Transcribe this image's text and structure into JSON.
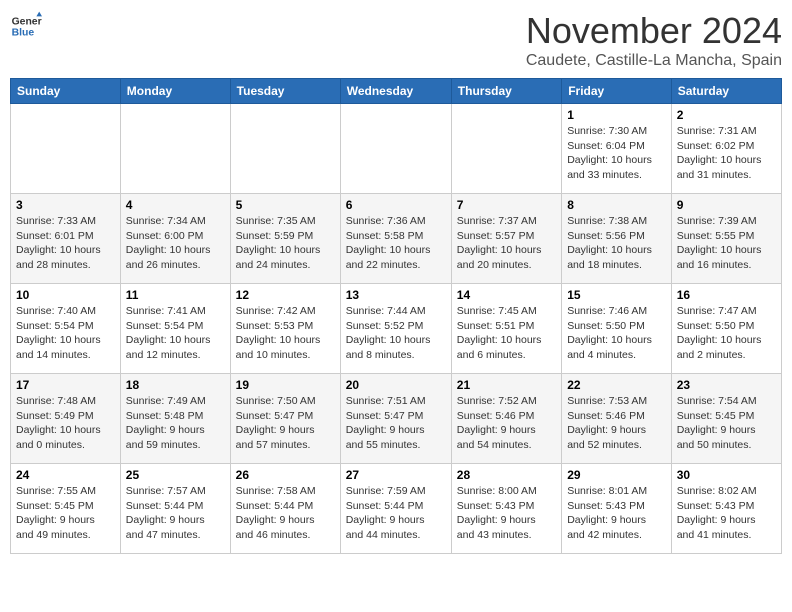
{
  "header": {
    "logo_general": "General",
    "logo_blue": "Blue",
    "month_title": "November 2024",
    "location": "Caudete, Castille-La Mancha, Spain"
  },
  "calendar": {
    "days_of_week": [
      "Sunday",
      "Monday",
      "Tuesday",
      "Wednesday",
      "Thursday",
      "Friday",
      "Saturday"
    ],
    "weeks": [
      [
        {
          "day": "",
          "info": ""
        },
        {
          "day": "",
          "info": ""
        },
        {
          "day": "",
          "info": ""
        },
        {
          "day": "",
          "info": ""
        },
        {
          "day": "",
          "info": ""
        },
        {
          "day": "1",
          "info": "Sunrise: 7:30 AM\nSunset: 6:04 PM\nDaylight: 10 hours\nand 33 minutes."
        },
        {
          "day": "2",
          "info": "Sunrise: 7:31 AM\nSunset: 6:02 PM\nDaylight: 10 hours\nand 31 minutes."
        }
      ],
      [
        {
          "day": "3",
          "info": "Sunrise: 7:33 AM\nSunset: 6:01 PM\nDaylight: 10 hours\nand 28 minutes."
        },
        {
          "day": "4",
          "info": "Sunrise: 7:34 AM\nSunset: 6:00 PM\nDaylight: 10 hours\nand 26 minutes."
        },
        {
          "day": "5",
          "info": "Sunrise: 7:35 AM\nSunset: 5:59 PM\nDaylight: 10 hours\nand 24 minutes."
        },
        {
          "day": "6",
          "info": "Sunrise: 7:36 AM\nSunset: 5:58 PM\nDaylight: 10 hours\nand 22 minutes."
        },
        {
          "day": "7",
          "info": "Sunrise: 7:37 AM\nSunset: 5:57 PM\nDaylight: 10 hours\nand 20 minutes."
        },
        {
          "day": "8",
          "info": "Sunrise: 7:38 AM\nSunset: 5:56 PM\nDaylight: 10 hours\nand 18 minutes."
        },
        {
          "day": "9",
          "info": "Sunrise: 7:39 AM\nSunset: 5:55 PM\nDaylight: 10 hours\nand 16 minutes."
        }
      ],
      [
        {
          "day": "10",
          "info": "Sunrise: 7:40 AM\nSunset: 5:54 PM\nDaylight: 10 hours\nand 14 minutes."
        },
        {
          "day": "11",
          "info": "Sunrise: 7:41 AM\nSunset: 5:54 PM\nDaylight: 10 hours\nand 12 minutes."
        },
        {
          "day": "12",
          "info": "Sunrise: 7:42 AM\nSunset: 5:53 PM\nDaylight: 10 hours\nand 10 minutes."
        },
        {
          "day": "13",
          "info": "Sunrise: 7:44 AM\nSunset: 5:52 PM\nDaylight: 10 hours\nand 8 minutes."
        },
        {
          "day": "14",
          "info": "Sunrise: 7:45 AM\nSunset: 5:51 PM\nDaylight: 10 hours\nand 6 minutes."
        },
        {
          "day": "15",
          "info": "Sunrise: 7:46 AM\nSunset: 5:50 PM\nDaylight: 10 hours\nand 4 minutes."
        },
        {
          "day": "16",
          "info": "Sunrise: 7:47 AM\nSunset: 5:50 PM\nDaylight: 10 hours\nand 2 minutes."
        }
      ],
      [
        {
          "day": "17",
          "info": "Sunrise: 7:48 AM\nSunset: 5:49 PM\nDaylight: 10 hours\nand 0 minutes."
        },
        {
          "day": "18",
          "info": "Sunrise: 7:49 AM\nSunset: 5:48 PM\nDaylight: 9 hours\nand 59 minutes."
        },
        {
          "day": "19",
          "info": "Sunrise: 7:50 AM\nSunset: 5:47 PM\nDaylight: 9 hours\nand 57 minutes."
        },
        {
          "day": "20",
          "info": "Sunrise: 7:51 AM\nSunset: 5:47 PM\nDaylight: 9 hours\nand 55 minutes."
        },
        {
          "day": "21",
          "info": "Sunrise: 7:52 AM\nSunset: 5:46 PM\nDaylight: 9 hours\nand 54 minutes."
        },
        {
          "day": "22",
          "info": "Sunrise: 7:53 AM\nSunset: 5:46 PM\nDaylight: 9 hours\nand 52 minutes."
        },
        {
          "day": "23",
          "info": "Sunrise: 7:54 AM\nSunset: 5:45 PM\nDaylight: 9 hours\nand 50 minutes."
        }
      ],
      [
        {
          "day": "24",
          "info": "Sunrise: 7:55 AM\nSunset: 5:45 PM\nDaylight: 9 hours\nand 49 minutes."
        },
        {
          "day": "25",
          "info": "Sunrise: 7:57 AM\nSunset: 5:44 PM\nDaylight: 9 hours\nand 47 minutes."
        },
        {
          "day": "26",
          "info": "Sunrise: 7:58 AM\nSunset: 5:44 PM\nDaylight: 9 hours\nand 46 minutes."
        },
        {
          "day": "27",
          "info": "Sunrise: 7:59 AM\nSunset: 5:44 PM\nDaylight: 9 hours\nand 44 minutes."
        },
        {
          "day": "28",
          "info": "Sunrise: 8:00 AM\nSunset: 5:43 PM\nDaylight: 9 hours\nand 43 minutes."
        },
        {
          "day": "29",
          "info": "Sunrise: 8:01 AM\nSunset: 5:43 PM\nDaylight: 9 hours\nand 42 minutes."
        },
        {
          "day": "30",
          "info": "Sunrise: 8:02 AM\nSunset: 5:43 PM\nDaylight: 9 hours\nand 41 minutes."
        }
      ]
    ]
  }
}
